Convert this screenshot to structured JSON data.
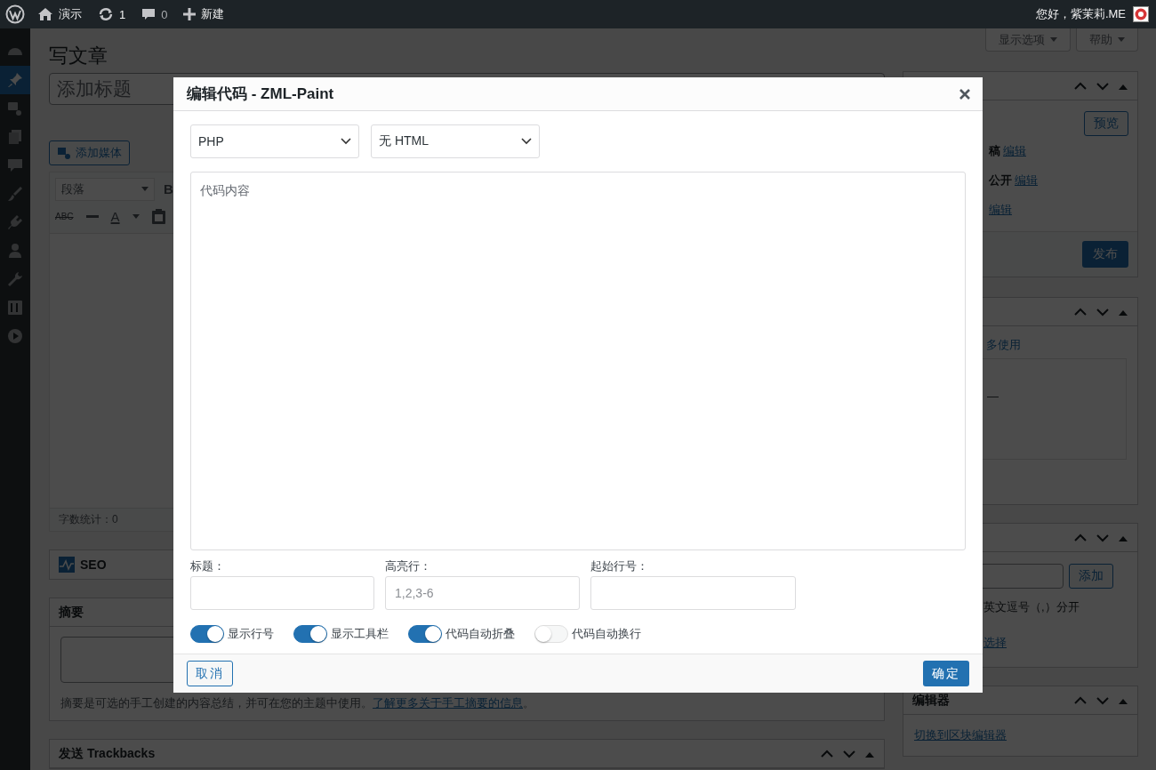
{
  "admin_bar": {
    "items": [
      {
        "kind": "logo"
      },
      {
        "kind": "home",
        "label": "演示"
      },
      {
        "kind": "updates",
        "label": "1"
      },
      {
        "kind": "comments",
        "label": "0"
      },
      {
        "kind": "new",
        "label": "新建"
      }
    ],
    "greeting": "您好，紫茉莉.ME"
  },
  "sidebar": {
    "items": [
      {
        "selected": false
      },
      {
        "selected": true
      },
      {
        "selected": false
      },
      {
        "selected": false
      },
      {
        "selected": false
      },
      {
        "selected": false
      },
      {
        "selected": false
      },
      {
        "selected": false
      },
      {
        "selected": false
      },
      {
        "selected": false
      },
      {
        "selected": false
      }
    ]
  },
  "screen_buttons": [
    "显示选项",
    "帮助"
  ],
  "page_title": "写文章",
  "editor": {
    "title_placeholder": "添加标题",
    "add_media": "添加媒体",
    "format_select": "段落",
    "toolbar": [
      {
        "kind": "bold",
        "label": "B"
      },
      {
        "kind": "strike",
        "label": "ABC"
      },
      {
        "kind": "rule"
      },
      {
        "kind": "color",
        "label": "A"
      },
      {
        "kind": "caret"
      },
      {
        "kind": "paste"
      }
    ],
    "word_count": "字数统计：0"
  },
  "seo_box": {
    "title": "SEO"
  },
  "excerpt_box": {
    "title": "摘要",
    "help": "摘要是可选的手工创建的内容总结，并可在您的主题中使用。",
    "link": "了解更多关于手工摘要的信息",
    "after": "。"
  },
  "trackbacks_box": {
    "title": "发送 Trackbacks"
  },
  "publish_box": {
    "preview": "预览",
    "rows": [
      {
        "text": "稿",
        "link": "编辑"
      },
      {
        "text": "公开",
        "link": "编辑"
      },
      {
        "link": "编辑"
      }
    ],
    "publish": "发布"
  },
  "category_box": {
    "tab": "多使用",
    "items": [
      "—"
    ]
  },
  "tags_box": {
    "add": "添加",
    "hint": "英文逗号（,）分开",
    "link": "选择"
  },
  "editor_box": {
    "title": "编辑器",
    "link": "切换到区块编辑器"
  },
  "dialog": {
    "title": "编辑代码 - ZML-Paint",
    "selects": [
      {
        "value": "PHP"
      },
      {
        "value": "无 HTML"
      }
    ],
    "code_placeholder": "代码内容",
    "fields": [
      {
        "label": "标题："
      },
      {
        "label": "高亮行：",
        "placeholder": "1,2,3-6"
      },
      {
        "label": "起始行号："
      }
    ],
    "toggles": [
      {
        "label": "显示行号",
        "on": true
      },
      {
        "label": "显示工具栏",
        "on": true
      },
      {
        "label": "代码自动折叠",
        "on": true
      },
      {
        "label": "代码自动换行",
        "on": false
      }
    ],
    "cancel": "取消",
    "confirm": "确定"
  }
}
